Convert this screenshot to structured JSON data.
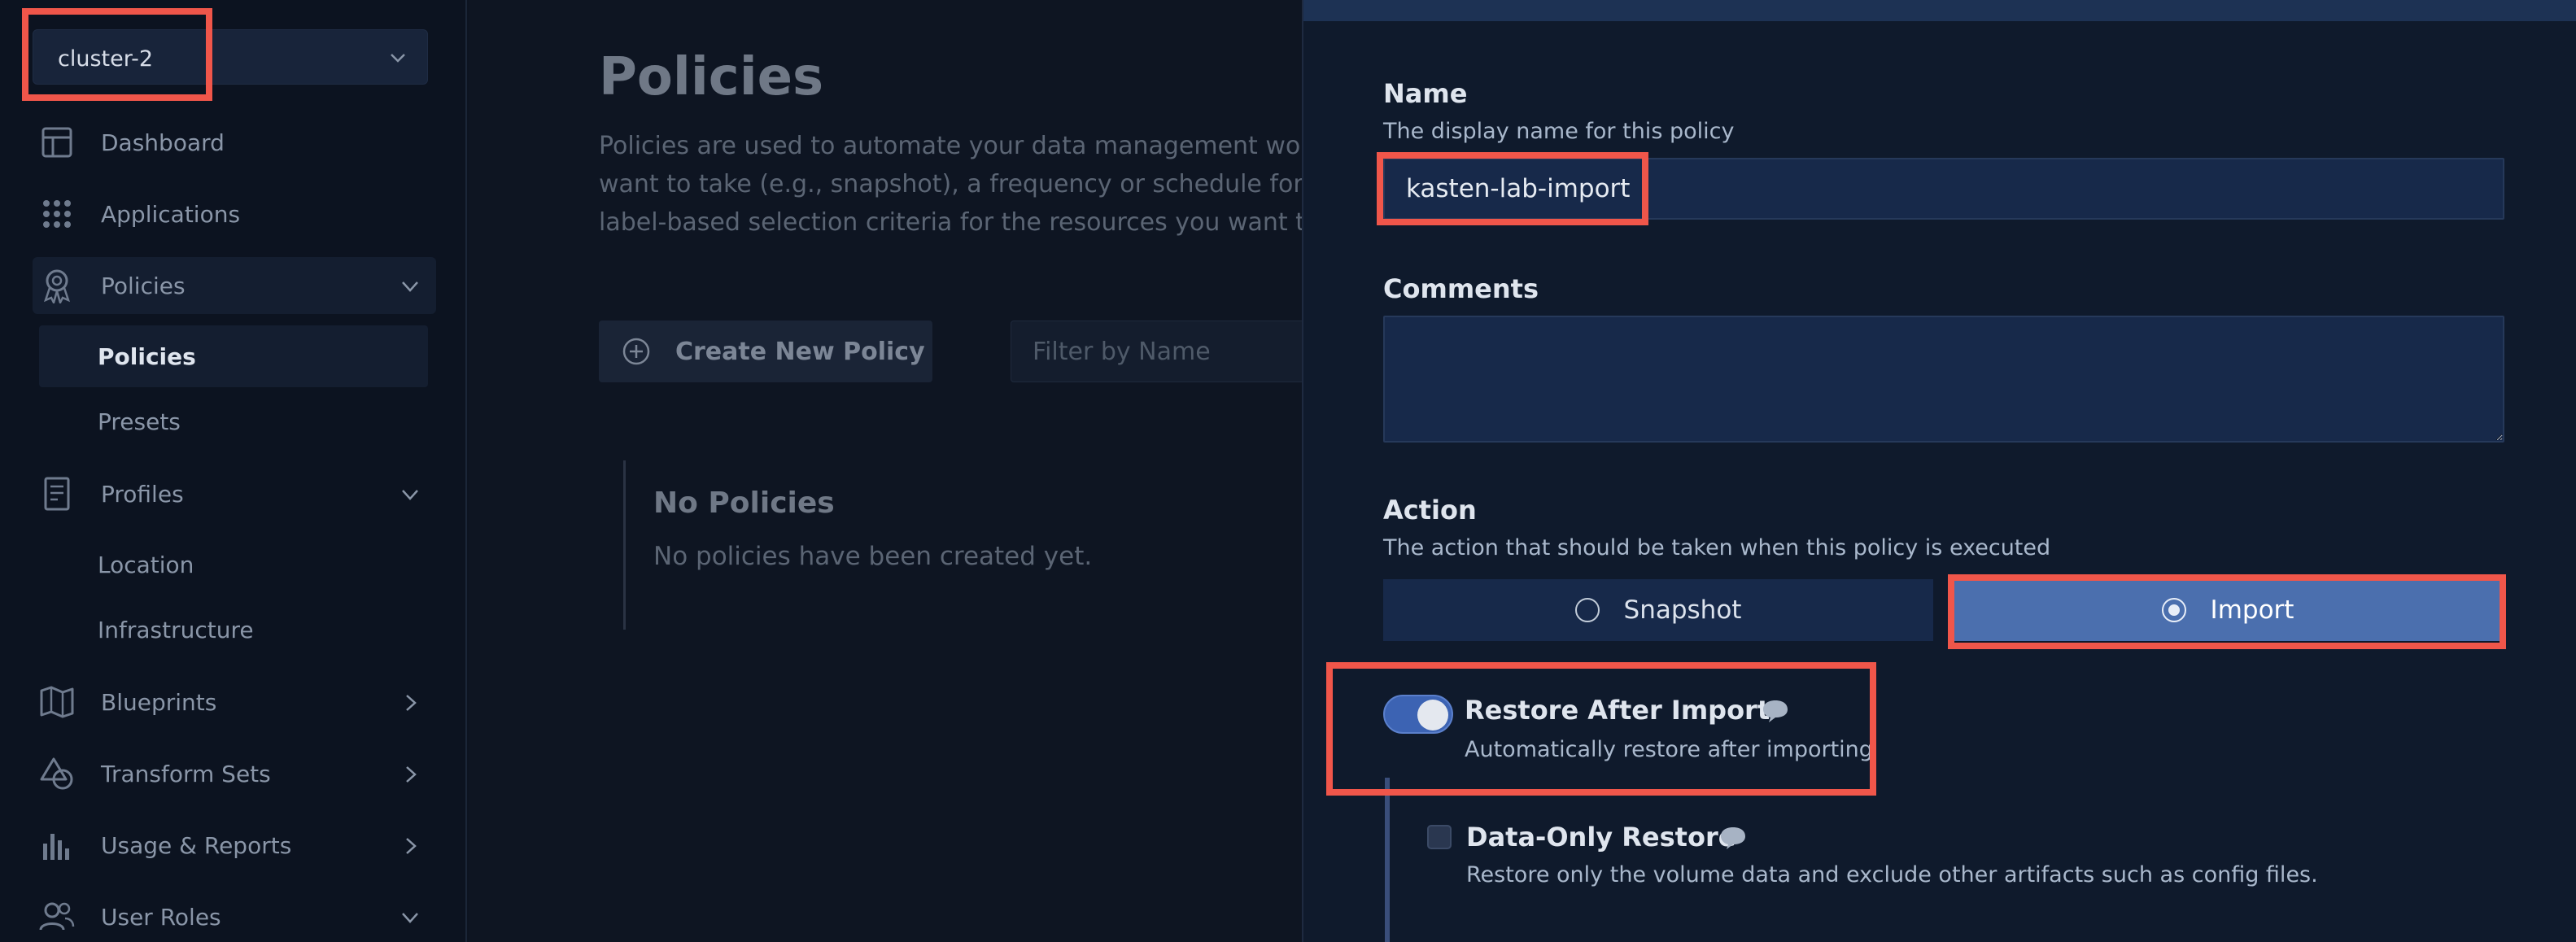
{
  "sidebar": {
    "cluster": "cluster-2",
    "nav": {
      "dashboard": "Dashboard",
      "applications": "Applications",
      "policies": "Policies",
      "policies_sub": [
        "Policies",
        "Presets"
      ],
      "profiles": "Profiles",
      "profiles_sub": [
        "Location",
        "Infrastructure"
      ],
      "blueprints": "Blueprints",
      "transform_sets": "Transform Sets",
      "usage_reports": "Usage & Reports",
      "user_roles": "User Roles"
    }
  },
  "main": {
    "title": "Policies",
    "description_lines": [
      "Policies are used to automate your data management wor",
      "want to take (e.g., snapshot), a frequency or schedule for h",
      "label-based selection criteria for the resources you want to"
    ],
    "create_button": "Create New Policy",
    "filter_placeholder": "Filter by Name",
    "empty_title": "No Policies",
    "empty_desc": "No policies have been created yet."
  },
  "panel": {
    "name_label": "Name",
    "name_help": "The display name for this policy",
    "name_value": "kasten-lab-import",
    "comments_label": "Comments",
    "action_label": "Action",
    "action_help": "The action that should be taken when this policy is executed",
    "action_options": [
      "Snapshot",
      "Import"
    ],
    "action_selected": "Import",
    "restore_title": "Restore After Import",
    "restore_desc": "Automatically restore after importing",
    "restore_enabled": true,
    "data_only_title": "Data-Only Restore",
    "data_only_desc": "Restore only the volume data and exclude other artifacts such as config files.",
    "data_only_checked": false
  },
  "colors": {
    "accent": "#4b6fae",
    "highlight": "#f0564a",
    "panel_bg": "#0f1a2c"
  }
}
